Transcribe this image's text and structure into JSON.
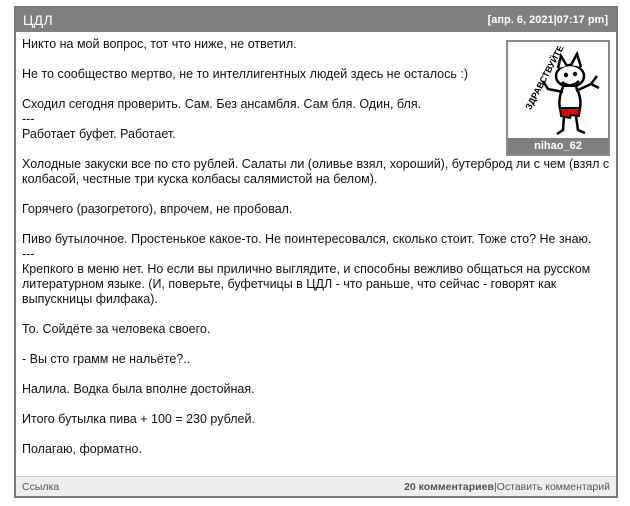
{
  "post": {
    "title": "ЦДЛ",
    "date": "[апр. 6, 2021|07:17 pm]",
    "author": {
      "username": "nihao_62",
      "avatar_icon": "cartoon-character-icon",
      "avatar_text": "ЗДРАВСТВУЙТЕ!"
    },
    "paragraphs": [
      "Никто на мой вопрос, тот что ниже, не ответил.",
      "Не то сообщество мертво, не то интеллигентных людей здесь не осталось :)",
      "Сходил сегодня проверить. Сам. Без ансамбля. Сам бля. Один, бля.",
      "---",
      "Работает буфет. Работает.",
      "Холодные закуски все по сто рублей. Салаты ли (оливье взял, хороший), бутерброд ли с чем (взял с колбасой, честные три куска колбасы салямистой на белом).",
      "Горячего (разогретого), впрочем, не пробовал.",
      "Пиво бутылочное. Простенькое какое-то. Не поинтересовался, сколько стоит. Тоже сто? Не знаю.",
      "---",
      "Крепкого в меню нет. Но если вы прилично выглядите, и способны вежливо общаться на русском литературном языке. (И, поверьте, буфетчицы в ЦДЛ - что раньше, что сейчас - говорят как выпускницы филфака).",
      "То. Сойдёте за человека своего.",
      "- Вы сто грамм не нальёте?..",
      "Налила. Водка была вполне достойная.",
      "Итого бутылка пива + 100 = 230 рублей.",
      "Полагаю, форматно."
    ]
  },
  "footer": {
    "link_label": "Ссылка",
    "comments_count": "20 комментариев",
    "separator": "|",
    "add_comment": "Оставить комментарий"
  }
}
